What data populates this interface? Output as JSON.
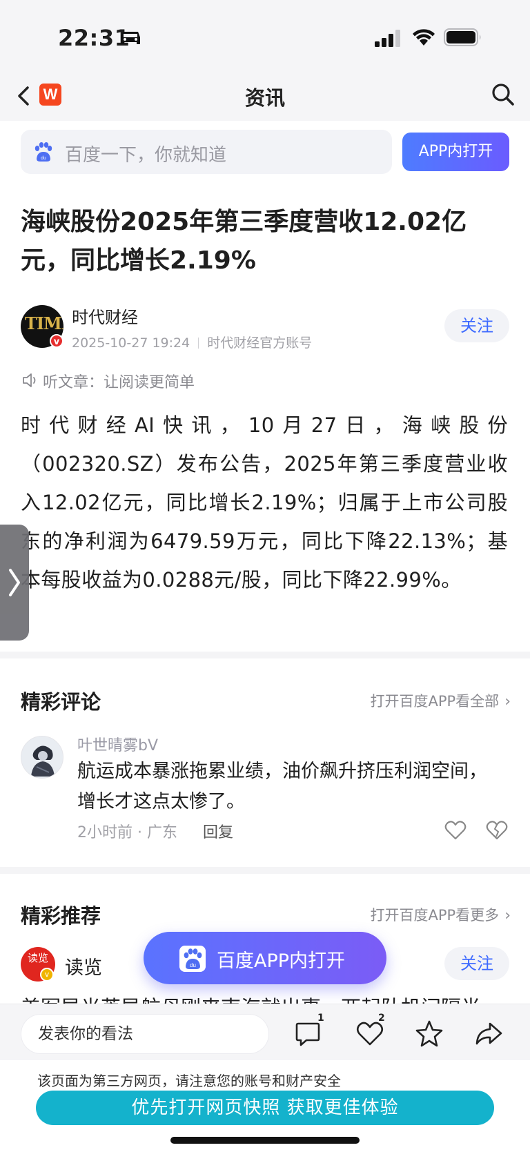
{
  "status_bar": {
    "time": "22:31"
  },
  "nav": {
    "title": "资讯",
    "logo_letter": "W"
  },
  "search": {
    "placeholder": "百度一下，你就知道",
    "app_button": "APP内打开"
  },
  "article": {
    "title": "海峡股份2025年第三季度营收12.02亿元，同比增长2.19%",
    "author": "时代财经",
    "avatar_text": "TIME",
    "date": "2025-10-27 19:24",
    "account_type": "时代财经官方账号",
    "follow_label": "关注",
    "listen_label": "听文章：让阅读更简单",
    "body": "时代财经AI快讯，10月27日，海峡股份（002320.SZ）发布公告，2025年第三季度营业收入12.02亿元，同比增长2.19%；归属于上市公司股东的净利润为6479.59万元，同比下降22.13%；基本每股收益为0.0288元/股，同比下降22.99%。"
  },
  "comments": {
    "section_title": "精彩评论",
    "open_all_link": "打开百度APP看全部",
    "items": [
      {
        "user": "叶世晴雾bV",
        "text": "航运成本暴涨拖累业绩，油价飙升挤压利润空间，增长才这点太惨了。",
        "time_location": "2小时前 · 广东",
        "reply_label": "回复"
      }
    ]
  },
  "recommend": {
    "section_title": "精彩推荐",
    "open_more_link": "打开百度APP看更多",
    "source_avatar_text": "读览",
    "source_name": "读览",
    "follow_label": "关注",
    "snippet": "美军导光芦导航母刚来南海就出事，两起队机间隔半"
  },
  "floating_button": {
    "label": "百度APP内打开"
  },
  "bottom_bar": {
    "comment_placeholder": "发表你的看法",
    "comment_count": "1",
    "like_count": "2"
  },
  "footer": {
    "notice": "该页面为第三方网页，请注意您的账号和财产安全",
    "snapshot_button": "优先打开网页快照 获取更佳体验"
  },
  "colors": {
    "accent_blue": "#3d6aff",
    "app_button_gradient_start": "#4e7cff",
    "app_button_gradient_end": "#6a5cff",
    "snapshot_teal": "#14b2cc",
    "logo_orange": "#f5461f"
  }
}
